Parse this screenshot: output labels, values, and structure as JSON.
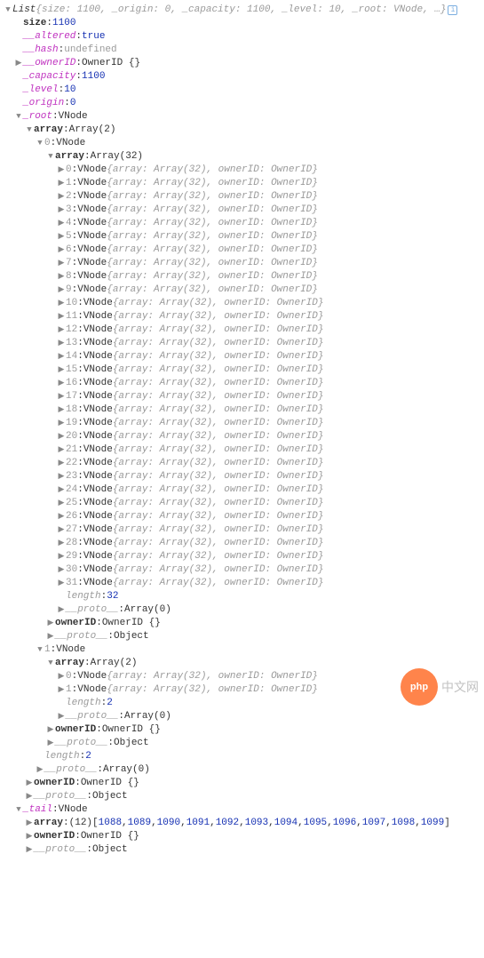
{
  "top": {
    "type": "List",
    "preview": "{size: 1100, _origin: 0, _capacity: 1100, _level: 10, _root: VNode, …}"
  },
  "props": {
    "size_key": "size",
    "size_val": "1100",
    "altered_key": "__altered",
    "altered_val": "true",
    "hash_key": "__hash",
    "hash_val": "undefined",
    "ownerID_key": "__ownerID",
    "ownerID_val": "OwnerID {}",
    "capacity_key": "_capacity",
    "capacity_val": "1100",
    "level_key": "_level",
    "level_val": "10",
    "origin_key": "_origin",
    "origin_val": "0",
    "root_key": "_root",
    "root_val": "VNode"
  },
  "arr2": {
    "key": "array",
    "val": "Array(2)"
  },
  "node0": {
    "key": "0",
    "val": "VNode",
    "innerKey": "array",
    "innerVal": "Array(32)"
  },
  "vnode_line": {
    "sep": ": ",
    "type": "VNode ",
    "body": "{array: Array(32), ownerID: OwnerID}"
  },
  "length32": {
    "key": "length",
    "val": "32"
  },
  "proto_arr0": {
    "key": "__proto__",
    "val": "Array(0)"
  },
  "ownerID_line": {
    "key": "ownerID",
    "val": "OwnerID {}"
  },
  "proto_obj": {
    "key": "__proto__",
    "val": "Object"
  },
  "node1": {
    "key": "1",
    "val": "VNode",
    "innerKey": "array",
    "innerVal": "Array(2)"
  },
  "length2": {
    "key": "length",
    "val": "2"
  },
  "tail": {
    "key": "_tail",
    "val": "VNode",
    "arr_key": "array",
    "arr_prefix": "(12) ",
    "values": [
      "1088",
      "1089",
      "1090",
      "1091",
      "1092",
      "1093",
      "1094",
      "1095",
      "1096",
      "1097",
      "1098",
      "1099"
    ]
  },
  "badge": "i",
  "watermark": {
    "php": "php",
    "txt": "中文网"
  }
}
